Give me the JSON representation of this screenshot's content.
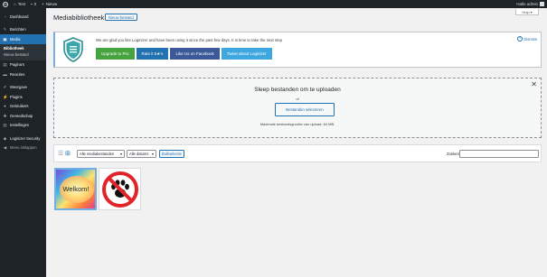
{
  "adminbar": {
    "site_name": "Test",
    "comments_count": "0",
    "new_label": "Nieuw",
    "greeting": "Hallo admin"
  },
  "sidebar": {
    "items": [
      {
        "label": "Dashboard",
        "icon": "dashboard-icon"
      },
      {
        "label": "Berichten",
        "icon": "pin-icon"
      },
      {
        "label": "Media",
        "icon": "media-icon"
      },
      {
        "label": "Pagina's",
        "icon": "page-icon"
      },
      {
        "label": "Reacties",
        "icon": "comment-icon"
      },
      {
        "label": "Weergave",
        "icon": "brush-icon"
      },
      {
        "label": "Plugins",
        "icon": "plug-icon"
      },
      {
        "label": "Gebruikers",
        "icon": "users-icon"
      },
      {
        "label": "Gereedschap",
        "icon": "wrench-icon"
      },
      {
        "label": "Instellingen",
        "icon": "settings-icon"
      },
      {
        "label": "Loginizer Security",
        "icon": "shield-icon"
      },
      {
        "label": "Menu inklappen",
        "icon": "collapse-icon"
      }
    ],
    "media_submenu": [
      "Bibliotheek",
      "Nieuw bestand"
    ]
  },
  "header": {
    "screen_options": "Hulp",
    "title": "Mediabibliotheek",
    "add_new": "Nieuw bestand"
  },
  "notice": {
    "text": "We are glad you like Loginizer and have been using it since the past few days. It is time to take the next step",
    "buttons": [
      {
        "label": "Upgrade to Pro",
        "color": "#46a33f"
      },
      {
        "label": "Rate it 5★'s",
        "color": "#2271b1"
      },
      {
        "label": "Like Us on Facebook",
        "color": "#3b5998"
      },
      {
        "label": "Tweet about Loginizer",
        "color": "#3fa7e0"
      }
    ],
    "dismiss": "Dismiss",
    "accent": "#72aee6"
  },
  "uploader": {
    "drop_text": "Sleep bestanden om te uploaden",
    "or_text": "of",
    "select_button": "Bestanden selecteren",
    "max_size": "Maximale bestandsgrootte van upload: 64 MB."
  },
  "filters": {
    "type_select": "Alle mediabestanden",
    "date_select": "Alle datums",
    "bulk_button": "Bulkselectie",
    "search_label": "Zoeken"
  },
  "library": {
    "items": [
      {
        "caption": "Welkom!"
      },
      {
        "caption": ""
      }
    ]
  }
}
